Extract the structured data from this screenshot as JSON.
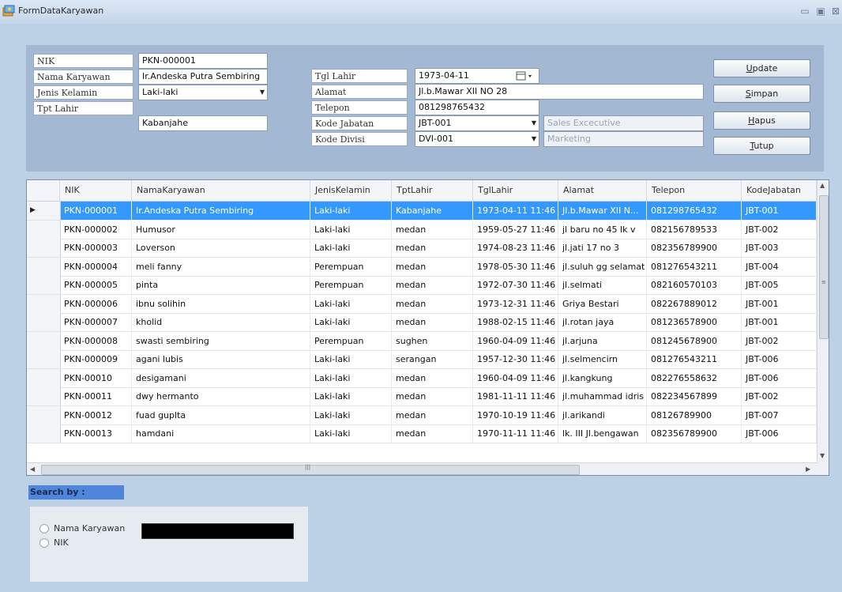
{
  "window": {
    "title": "FormDataKaryawan",
    "controls": {
      "minimize": "▭",
      "maximize": "▣",
      "close": "⊠"
    }
  },
  "form": {
    "labels": {
      "nik": "NIK",
      "nama": "Nama Karyawan",
      "jenis_kelamin": "Jenis Kelamin",
      "tpt_lahir": "Tpt Lahir",
      "tgl_lahir": "Tgl Lahir",
      "alamat": "Alamat",
      "telepon": "Telepon",
      "kode_jabatan": "Kode Jabatan",
      "kode_divisi": "Kode Divisi"
    },
    "values": {
      "nik": "PKN-000001",
      "nama": "Ir.Andeska Putra Sembiring",
      "jenis_kelamin": "Laki-laki",
      "tpt_lahir": "Kabanjahe",
      "tgl_lahir": "1973-04-11",
      "alamat": "Jl.b.Mawar XII NO 28",
      "telepon": "081298765432",
      "kode_jabatan": "JBT-001",
      "jabatan_name": "Sales Excecutive",
      "kode_divisi": "DVI-001",
      "divisi_name": "Marketing"
    },
    "datepicker_icon": "calendar-icon"
  },
  "buttons": {
    "update": {
      "u": "U",
      "rest": "pdate"
    },
    "simpan": {
      "u": "S",
      "rest": "impan"
    },
    "hapus": {
      "u": "H",
      "rest": "apus"
    },
    "tutup": {
      "u": "T",
      "rest": "utup"
    }
  },
  "grid": {
    "columns": [
      "NIK",
      "NamaKaryawan",
      "JenisKelamin",
      "TptLahir",
      "TglLahir",
      "Alamat",
      "Telepon",
      "KodeJabatan"
    ],
    "rows": [
      [
        "PKN-000001",
        "Ir.Andeska Putra Sembiring",
        "Laki-laki",
        "Kabanjahe",
        "1973-04-11 11:46",
        "Jl.b.Mawar XII N...",
        "081298765432",
        "JBT-001"
      ],
      [
        "PKN-000002",
        "Humusor",
        "Laki-laki",
        "medan",
        "1959-05-27 11:46",
        "jl baru no 45 lk v",
        "082156789533",
        "JBT-002"
      ],
      [
        "PKN-000003",
        "Loverson",
        "Laki-laki",
        "medan",
        "1974-08-23 11:46",
        "jl.jati  17 no 3",
        "082356789900",
        "JBT-003"
      ],
      [
        "PKN-000004",
        "meli fanny",
        "Perempuan",
        "medan",
        "1978-05-30 11:46",
        "jl.suluh gg selamat",
        "081276543211",
        "JBT-004"
      ],
      [
        "PKN-000005",
        "pinta",
        "Perempuan",
        "medan",
        "1972-07-30 11:46",
        "jl.selmati",
        "082160570103",
        "JBT-005"
      ],
      [
        "PKN-000006",
        "ibnu solihin",
        "Laki-laki",
        "medan",
        "1973-12-31 11:46",
        "Griya Bestari",
        "082267889012",
        "JBT-001"
      ],
      [
        "PKN-000007",
        "kholid",
        "Laki-laki",
        "medan",
        "1988-02-15 11:46",
        "jl.rotan jaya",
        "081236578900",
        "JBT-001"
      ],
      [
        "PKN-000008",
        "swasti sembiring",
        "Perempuan",
        "sughen",
        "1960-04-09 11:46",
        "jl.arjuna",
        "081245678900",
        "JBT-002"
      ],
      [
        "PKN-000009",
        "agani lubis",
        "Laki-laki",
        "serangan",
        "1957-12-30 11:46",
        "jl.selmencirn",
        "081276543211",
        "JBT-006"
      ],
      [
        "PKN-00010",
        "desigamani",
        "Laki-laki",
        "medan",
        "1960-04-09 11:46",
        "jl.kangkung",
        "082276558632",
        "JBT-006"
      ],
      [
        "PKN-00011",
        "dwy hermanto",
        "Laki-laki",
        "medan",
        "1981-11-11 11:46",
        "jl.muhammad idris",
        "082234567899",
        "JBT-002"
      ],
      [
        "PKN-00012",
        "fuad guplta",
        "Laki-laki",
        "medan",
        "1970-10-19 11:46",
        "jl.arikandi",
        "08126789900",
        "JBT-007"
      ],
      [
        "PKN-00013",
        "hamdani",
        "Laki-laki",
        "medan",
        "1970-11-11 11:46",
        "lk. III Jl.bengawan",
        "082356789900",
        "JBT-006"
      ]
    ],
    "selected_row": 0
  },
  "search": {
    "label": "Search by :",
    "options": [
      "Nama Karyawan",
      "NIK"
    ],
    "input_value": ""
  },
  "colors": {
    "window_bg": "#bcd0e6",
    "panel_bg": "#a3b8d2",
    "selection": "#3399ff",
    "search_label_bg": "#4f86d9"
  }
}
